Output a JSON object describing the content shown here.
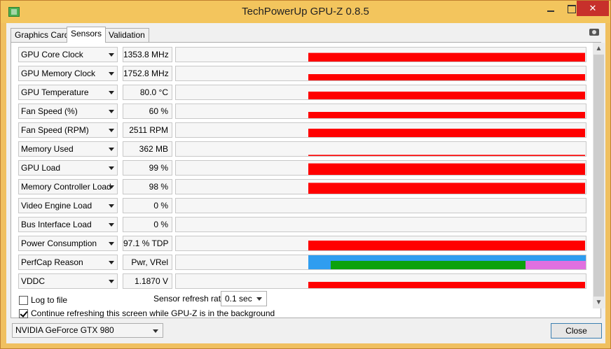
{
  "window": {
    "title": "TechPowerUp GPU-Z 0.8.5",
    "close_glyph": "✕"
  },
  "tabs": [
    {
      "label": "Graphics Card",
      "active": false
    },
    {
      "label": "Sensors",
      "active": true
    },
    {
      "label": "Validation",
      "active": false
    }
  ],
  "colors": {
    "graph_fill": "#ff0000",
    "perfcap_blue": "#2f9df0",
    "perfcap_green": "#0ca20c",
    "perfcap_pink": "#e070e0"
  },
  "sensors": [
    {
      "name": "GPU Core Clock",
      "value": "1353.8 MHz",
      "level": 0.62
    },
    {
      "name": "GPU Memory Clock",
      "value": "1752.8 MHz",
      "level": 0.45
    },
    {
      "name": "GPU Temperature",
      "value": "80.0 °C",
      "level": 0.55
    },
    {
      "name": "Fan Speed (%)",
      "value": "60 %",
      "level": 0.45
    },
    {
      "name": "Fan Speed (RPM)",
      "value": "2511 RPM",
      "level": 0.6
    },
    {
      "name": "Memory Used",
      "value": "362 MB",
      "level": 0.08
    },
    {
      "name": "GPU Load",
      "value": "99 %",
      "level": 0.82
    },
    {
      "name": "Memory Controller Load",
      "value": "98 %",
      "level": 0.78
    },
    {
      "name": "Video Engine Load",
      "value": "0 %",
      "level": 0
    },
    {
      "name": "Bus Interface Load",
      "value": "0 %",
      "level": 0
    },
    {
      "name": "Power Consumption",
      "value": "97.1 % TDP",
      "level": 0.7
    },
    {
      "name": "PerfCap Reason",
      "value": "Pwr, VRel",
      "level": 1
    },
    {
      "name": "VDDC",
      "value": "1.1870 V",
      "level": 0.45
    }
  ],
  "options": {
    "log_to_file": {
      "label": "Log to file",
      "checked": false
    },
    "continue_refresh": {
      "label": "Continue refreshing this screen while GPU-Z is in the background",
      "checked": true
    },
    "refresh_label": "Sensor refresh rate:",
    "refresh_value": "0.1 sec"
  },
  "footer": {
    "gpu_name": "NVIDIA GeForce GTX 980",
    "close_label": "Close"
  }
}
